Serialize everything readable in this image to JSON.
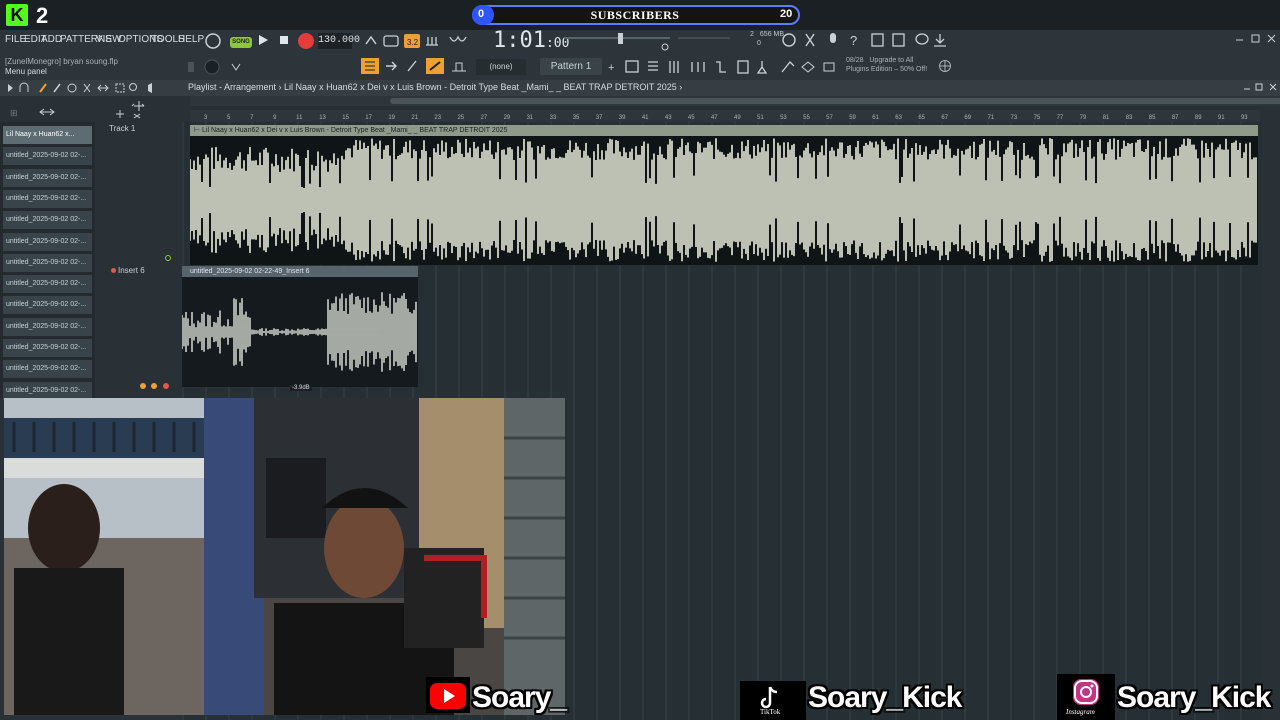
{
  "overlay": {
    "kick_count": "2",
    "subscribers_label": "SUBSCRIBERS",
    "subscribers_current": "0",
    "subscribers_goal": "20",
    "subscribers_progress": 0.0
  },
  "menu": {
    "items": [
      "FILE",
      "EDIT",
      "ADD",
      "PATTERNS",
      "VIEW",
      "OPTIONS",
      "TOOLS",
      "HELP"
    ]
  },
  "transport": {
    "song_label": "SONG",
    "tempo": "130.000",
    "time": "1:01",
    "time_sub": ":00",
    "cpu": "656 MB",
    "cpu_num": "2",
    "poly": "0"
  },
  "row2": {
    "project_user": "[ZunelMonegro] bryan soung.flp",
    "hint": "Menu panel",
    "pattern_none": "(none)",
    "pattern": "Pattern 1",
    "promo_date": "08/28",
    "promo_line1": "Upgrade to All",
    "promo_line2": "Plugins Edition – 50% Off!"
  },
  "playlist": {
    "title": "Playlist - Arrangement",
    "breadcrumb": "Lil Naay x Huan62 x Dei v x Luis Brown - Detroit Type Beat _Mami_ _ BEAT TRAP DETROIT 2025",
    "ruler": [
      "3",
      "5",
      "7",
      "9",
      "11",
      "13",
      "15",
      "17",
      "19",
      "21",
      "23",
      "25",
      "27",
      "29",
      "31",
      "33",
      "35",
      "37",
      "39",
      "41",
      "43",
      "45",
      "47",
      "49",
      "51",
      "53",
      "55",
      "57",
      "59",
      "61",
      "63",
      "65",
      "67",
      "69",
      "71",
      "73",
      "75",
      "77",
      "79",
      "81",
      "83",
      "85",
      "87",
      "89",
      "91",
      "93"
    ],
    "track1_label": "Track 1",
    "track6_label": "Insert 6",
    "clip1_name": "Lil Naay x Huan62 x Dei v x Luis Brown - Detroit Type Beat _Mami_ _ BEAT TRAP DETROIT 2025",
    "clip2_name": "untitled_2025-09-02 02-22-49_Insert 6",
    "clip2_db": "-3.9dB"
  },
  "browser": {
    "items": [
      "Lil Naay x Huan62 x...",
      "untitled_2025-09-02 02-...",
      "untitled_2025-09-02 02-...",
      "untitled_2025-09-02 02-...",
      "untitled_2025-09-02 02-...",
      "untitled_2025-09-02 02-...",
      "untitled_2025-09-02 02-...",
      "untitled_2025-09-02 02-...",
      "untitled_2025-09-02 02-...",
      "untitled_2025-09-02 02-...",
      "untitled_2025-09-02 02-...",
      "untitled_2025-09-02 02-...",
      "untitled_2025-09-02 02-..."
    ]
  },
  "socials": {
    "youtube": "Soary_",
    "tiktok": "Soary_Kick",
    "tiktok_caption": "TikTok",
    "instagram": "Soary_Kick",
    "instagram_caption": "Instagram"
  },
  "colors": {
    "kick_green": "#53fc18",
    "sub_bar_border": "#5b7cff",
    "waveform": "#e9ecdc",
    "record": "#e63b3b"
  }
}
